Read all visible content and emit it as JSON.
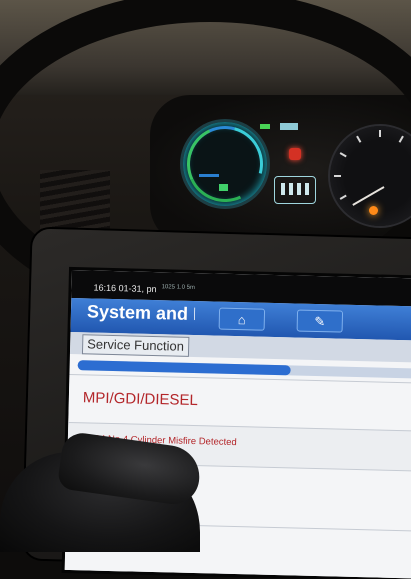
{
  "statusbar": {
    "time": "16:16  01-31, pn",
    "battery_text": "1025  1.0  5m"
  },
  "header": {
    "title": "System and F",
    "buttons": [
      {
        "icon": "home-icon",
        "glyph": "⌂"
      },
      {
        "icon": "report-icon",
        "glyph": "✎"
      }
    ]
  },
  "breadcrumb": "Service Function",
  "progress": {
    "fraction": 0.62
  },
  "rows": [
    {
      "label": "MPI/GDI/DIESEL"
    },
    {
      "label": "P0304 No.4 Cylinder Misfire Detected"
    }
  ],
  "colors": {
    "header_blue": "#2a66c4",
    "progress_blue": "#2c6dd1",
    "row_text_red": "#b3262a"
  }
}
